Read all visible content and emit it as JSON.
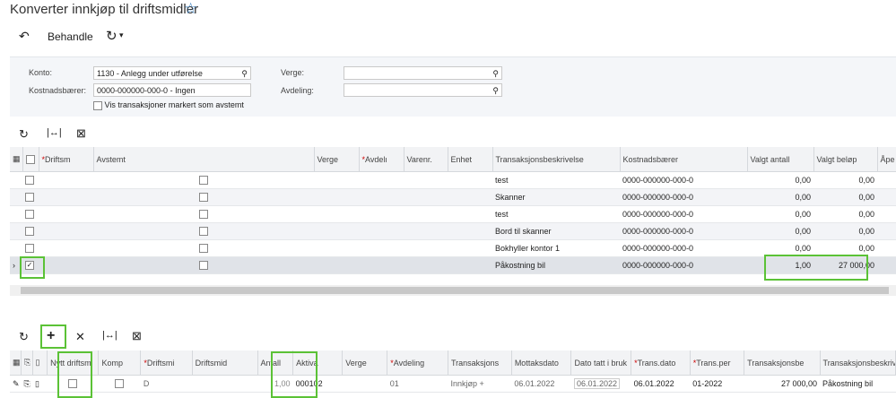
{
  "header": {
    "title": "Konverter innkjøp til driftsmidler"
  },
  "toolbar": {
    "undo_label": "",
    "process_label": "Behandle",
    "refresh_label": "▾"
  },
  "filters": {
    "konto_label": "Konto:",
    "konto_value": "1130 - Anlegg under utførelse",
    "kostnad_label": "Kostnadsbærer:",
    "kostnad_value": "0000-000000-000-0 - Ingen",
    "verge_label": "Verge:",
    "verge_value": "",
    "avdeling_label": "Avdeling:",
    "avdeling_value": "",
    "vis_label": "Vis transaksjoner markert som avstemt"
  },
  "top_grid": {
    "headers": {
      "driftsm": "Driftsm",
      "avstemt": "Avstemt",
      "verge": "Verge",
      "avdeling": "Avdelı",
      "varenr": "Varenr.",
      "enhet": "Enhet",
      "trans_beskr": "Transaksjonsbeskrivelse",
      "kostnad": "Kostnadsbærer",
      "valgt_antall": "Valgt antall",
      "valgt_belop": "Valgt beløp",
      "apen": "Åpe"
    },
    "rows": [
      {
        "beskr": "test",
        "kostnad": "0000-000000-000-0",
        "antall": "0,00",
        "belop": "0,00"
      },
      {
        "beskr": "Skanner",
        "kostnad": "0000-000000-000-0",
        "antall": "0,00",
        "belop": "0,00"
      },
      {
        "beskr": "test",
        "kostnad": "0000-000000-000-0",
        "antall": "0,00",
        "belop": "0,00"
      },
      {
        "beskr": "Bord til skanner",
        "kostnad": "0000-000000-000-0",
        "antall": "0,00",
        "belop": "0,00"
      },
      {
        "beskr": "Bokhyller kontor 1",
        "kostnad": "0000-000000-000-0",
        "antall": "0,00",
        "belop": "0,00"
      },
      {
        "beskr": "Påkostning bil",
        "kostnad": "0000-000000-000-0",
        "antall": "1,00",
        "belop": "27 000,00"
      }
    ]
  },
  "bottom_grid": {
    "headers": {
      "nytt": "Nytt driftsm",
      "komp": "Komp",
      "driftsmi": "Driftsmi",
      "driftsmid": "Driftsmid",
      "antall": "Antall",
      "aktiva": "Aktiva",
      "verge": "Verge",
      "avdeling": "Avdeling",
      "transaksjons": "Transaksjons",
      "mottaksdato": "Mottaksdato",
      "dato_tatt": "Dato tatt i bruk",
      "trans_dato": "Trans.dato",
      "trans_per": "Trans.per",
      "trans_belop": "Transaksjonsbe",
      "trans_beskr": "Transaksjonsbeskrive"
    },
    "row": {
      "driftsmi": "D",
      "antall": "1,00",
      "aktiva": "000102",
      "avdeling": "01",
      "transaksjons": "Innkjøp +",
      "mottaksdato": "06.01.2022",
      "dato_tatt": "06.01.2022",
      "trans_dato": "06.01.2022",
      "trans_per": "01-2022",
      "trans_belop": "27 000,00",
      "trans_beskr": "Påkostning bil"
    }
  },
  "colors": {
    "accent": "#5bc236",
    "star": "#3b82c4"
  }
}
